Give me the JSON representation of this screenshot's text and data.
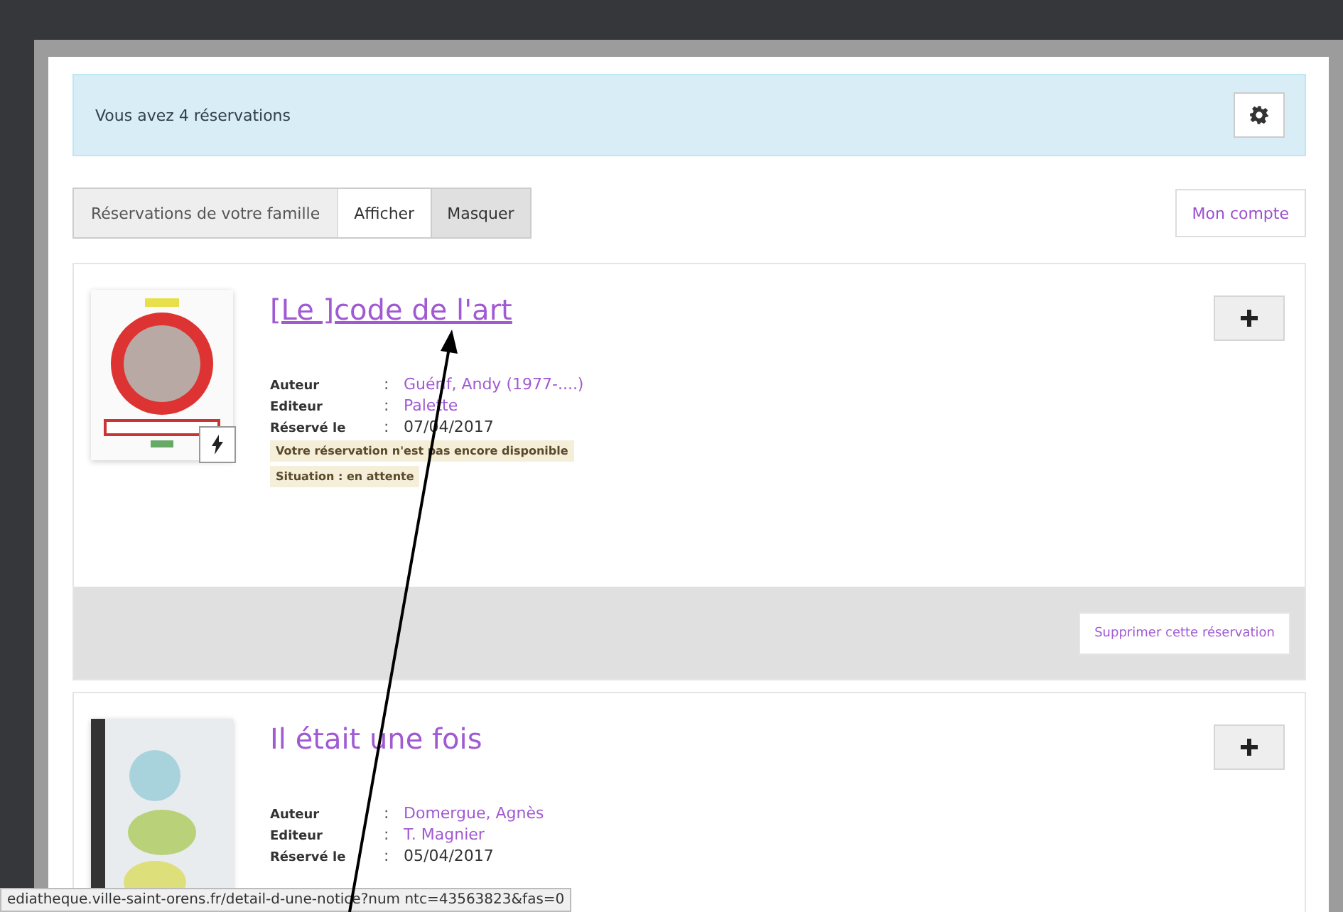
{
  "alert": {
    "text": "Vous avez 4 réservations"
  },
  "family_toggle": {
    "label": "Réservations de votre famille",
    "options": [
      {
        "label": "Afficher",
        "selected": false
      },
      {
        "label": "Masquer",
        "selected": true
      }
    ]
  },
  "account_link": "Mon compte",
  "reservations": [
    {
      "title": "[Le ]code de l'art",
      "hovered": true,
      "kind": "sign",
      "fields": [
        {
          "label": "Auteur",
          "separator": ":",
          "value": "Guérif, Andy (1977-....)",
          "link": true
        },
        {
          "label": "Editeur",
          "separator": ":",
          "value": "Palette",
          "link": true
        },
        {
          "label": "Réservé le",
          "separator": ":",
          "value": "07/04/2017",
          "link": false
        }
      ],
      "notes": [
        "Votre réservation n'est pas encore disponible",
        "Situation : en attente"
      ],
      "delete_button": "Supprimer cette réservation"
    },
    {
      "title": "Il était une fois",
      "hovered": false,
      "kind": "illustration",
      "fields": [
        {
          "label": "Auteur",
          "separator": ":",
          "value": "Domergue, Agnès",
          "link": true
        },
        {
          "label": "Editeur",
          "separator": ":",
          "value": "T. Magnier",
          "link": true
        },
        {
          "label": "Réservé le",
          "separator": ":",
          "value": "05/04/2017",
          "link": false
        }
      ]
    }
  ],
  "status_bar": {
    "url": "ediatheque.ville-saint-orens.fr/detail-d-une-notice?num ntc=43563823&fas=0"
  }
}
